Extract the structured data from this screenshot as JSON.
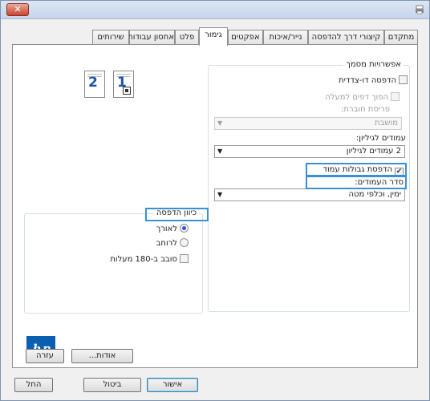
{
  "titlebar": {
    "close_label": "✕"
  },
  "tabs": [
    {
      "label": "מתקדם"
    },
    {
      "label": "קיצורי דרך להדפסה"
    },
    {
      "label": "נייר/איכות"
    },
    {
      "label": "אפקטים"
    },
    {
      "label": "גימור"
    },
    {
      "label": "פלט"
    },
    {
      "label": "אחסון עבודות"
    },
    {
      "label": "שירותים"
    }
  ],
  "active_tab": "גימור",
  "document_options": {
    "group_label": "אפשרויות מסמך",
    "duplex_label": "הדפסה דו-צדדית",
    "flip_pages_label": "הפוך דפים למעלה",
    "booklet_layout_label": "פריסת חוברת:",
    "booklet_value": "מושבת",
    "pages_per_sheet_label": "עמודים לגיליון:",
    "pages_per_sheet_value": "2 עמודים לגיליון",
    "print_borders_label": "הדפסת גבולות עמוד",
    "page_order_label": "סדר העמודים:",
    "page_order_value": "ימין, וכלפי מטה"
  },
  "preview": {
    "page_one": "1",
    "page_two": "2"
  },
  "orientation": {
    "group_label": "כיוון הדפסה",
    "portrait_label": "לאורך",
    "landscape_label": "לרוחב",
    "rotate_label": "סובב ב-180 מעלות"
  },
  "panel_buttons": {
    "about": "אודות...",
    "help": "עזרה"
  },
  "dialog_buttons": {
    "ok": "אישור",
    "cancel": "ביטול",
    "apply": "החל"
  },
  "colors": {
    "highlight": "#3b8fd5",
    "accent": "#2a5bd7"
  }
}
